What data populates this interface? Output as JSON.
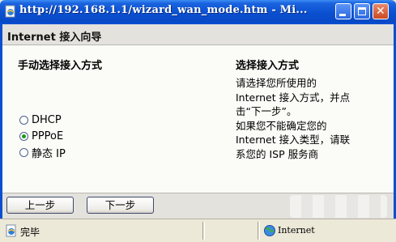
{
  "window": {
    "title": "http://192.168.1.1/wizard_wan_mode.htm - Mi..."
  },
  "wizard": {
    "title": "Internet 接入向导",
    "left_heading": "手动选择接入方式",
    "options": [
      {
        "label": "DHCP",
        "checked": false
      },
      {
        "label": "PPPoE",
        "checked": true
      },
      {
        "label": "静态 IP",
        "checked": false
      }
    ],
    "right_heading": "选择接入方式",
    "help_lines": [
      "请选择您所使用的",
      "Internet 接入方式，并点",
      "击“下一步”。",
      "如果您不能确定您的",
      "Internet 接入类型，请联",
      "系您的 ISP 服务商"
    ],
    "prev_label": "上一步",
    "next_label": "下一步"
  },
  "status": {
    "text": "完毕",
    "zone": "Internet"
  },
  "colors": {
    "titlebar": "#0a4fd0",
    "radio_checked": "#1a9a1a"
  },
  "icons": [
    "ie-page-icon",
    "minimize-icon",
    "maximize-icon",
    "close-icon",
    "globe-icon"
  ]
}
